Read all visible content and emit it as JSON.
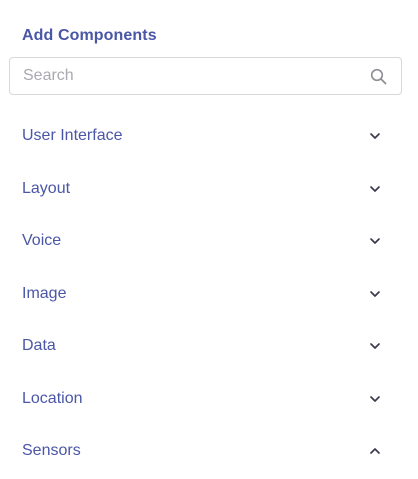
{
  "panel": {
    "title": "Add Components",
    "search": {
      "placeholder": "Search",
      "value": "",
      "icon": "search-icon"
    },
    "categories": [
      {
        "label": "User Interface",
        "expanded": false
      },
      {
        "label": "Layout",
        "expanded": false
      },
      {
        "label": "Voice",
        "expanded": false
      },
      {
        "label": "Image",
        "expanded": false
      },
      {
        "label": "Data",
        "expanded": false
      },
      {
        "label": "Location",
        "expanded": false
      },
      {
        "label": "Sensors",
        "expanded": true
      }
    ]
  },
  "colors": {
    "accent": "#4a56a6",
    "border": "#d7d7dc",
    "placeholder": "#a9a9b0",
    "icon": "#8e8e96",
    "chevron": "#3a3a4a"
  }
}
